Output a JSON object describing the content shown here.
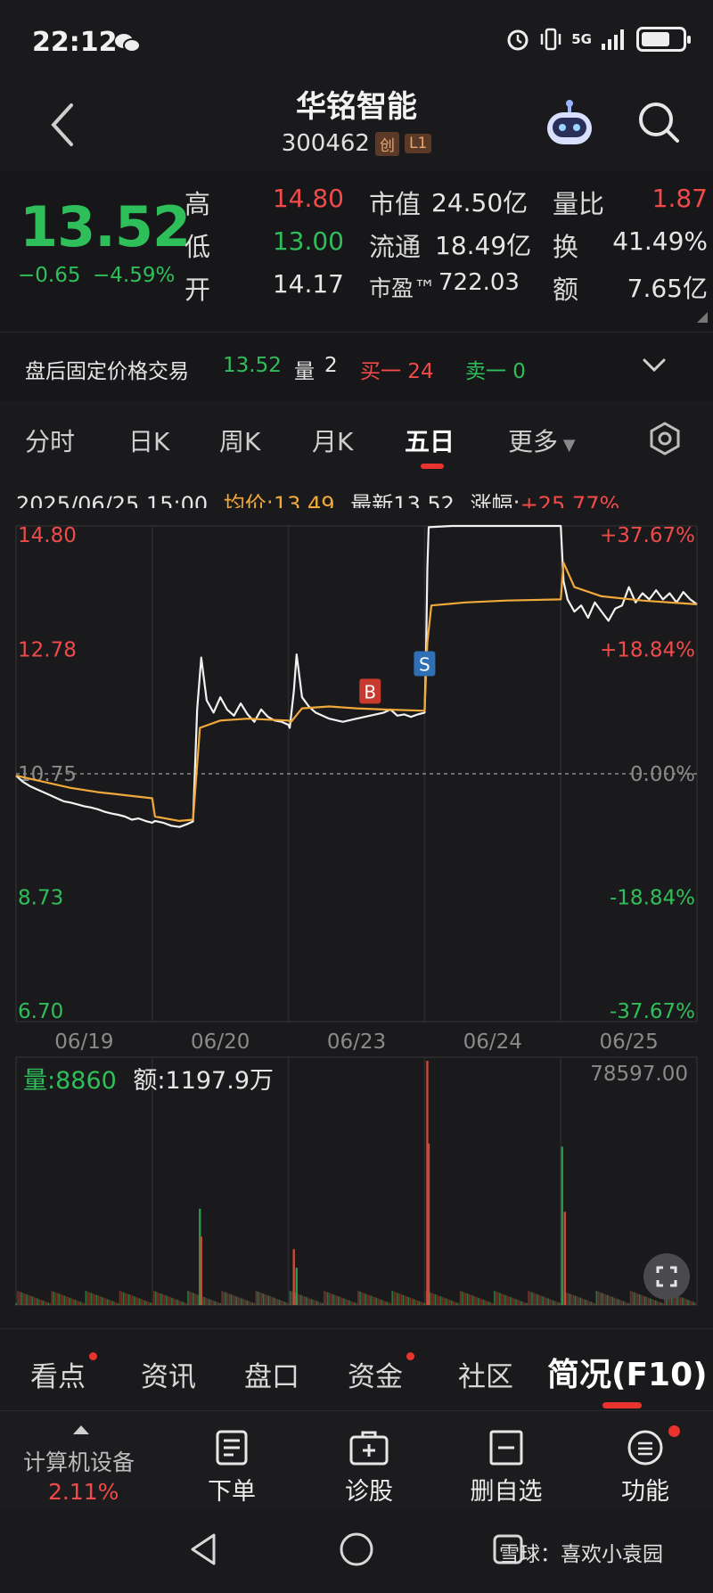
{
  "status": {
    "time": "22:12",
    "network": "5G",
    "battery_level": 0.7,
    "icons": [
      "wechat-icon",
      "alarm-icon",
      "vibrate-icon",
      "signal-icon",
      "battery-icon"
    ]
  },
  "header": {
    "name": "华铭智能",
    "code": "300462",
    "tags": [
      "创",
      "L1"
    ]
  },
  "quote": {
    "price": "13.52",
    "change": "−0.65",
    "change_pct": "−4.59%",
    "rows": [
      {
        "l1": "高",
        "v1": "14.80",
        "l2": "市值",
        "v2": "24.50亿",
        "l3": "量比",
        "v3": "1.87"
      },
      {
        "l1": "低",
        "v1": "13.00",
        "l2": "流通",
        "v2": "18.49亿",
        "l3": "换",
        "v3": "41.49%"
      },
      {
        "l1": "开",
        "v1": "14.17",
        "l2": "市盈™",
        "v2": "722.03",
        "l3": "额",
        "v3": "7.65亿"
      }
    ]
  },
  "after_hours": {
    "label": "盘后固定价格交易",
    "price": "13.52",
    "vol_label": "量",
    "vol": "2",
    "buy": "买一 24",
    "sell": "卖一 0"
  },
  "tabs": [
    "分时",
    "日K",
    "周K",
    "月K",
    "五日",
    "更多"
  ],
  "active_tab": "五日",
  "info_line": {
    "datetime": "2025/06/25 15:00",
    "avg": "均价:13.49",
    "latest": "最新13.52",
    "change_label": "涨幅:",
    "change": "+25.77%"
  },
  "chart_data": {
    "type": "line",
    "title": "",
    "dates": [
      "06/19",
      "06/20",
      "06/23",
      "06/24",
      "06/25"
    ],
    "y_ticks_left": [
      "14.80",
      "12.78",
      "10.75",
      "8.73",
      "6.70"
    ],
    "y_ticks_right": [
      "+37.67%",
      "+18.84%",
      "0.00%",
      "-18.84%",
      "-37.67%"
    ],
    "ylim": [
      6.7,
      14.8
    ],
    "base_price": 10.75,
    "series": [
      {
        "values": [
          [
            0.0,
            10.72
          ],
          [
            0.05,
            10.62
          ],
          [
            0.1,
            10.55
          ],
          [
            0.15,
            10.5
          ],
          [
            0.2,
            10.45
          ],
          [
            0.25,
            10.4
          ],
          [
            0.3,
            10.35
          ],
          [
            0.35,
            10.3
          ],
          [
            0.4,
            10.28
          ],
          [
            0.45,
            10.25
          ],
          [
            0.5,
            10.22
          ],
          [
            0.55,
            10.2
          ],
          [
            0.6,
            10.17
          ],
          [
            0.65,
            10.13
          ],
          [
            0.7,
            10.1
          ],
          [
            0.75,
            10.08
          ],
          [
            0.8,
            10.05
          ],
          [
            0.85,
            10.0
          ],
          [
            0.9,
            10.02
          ],
          [
            0.95,
            9.98
          ],
          [
            1.0,
            9.95
          ],
          [
            1.02,
            9.98
          ],
          [
            1.08,
            9.95
          ],
          [
            1.14,
            9.9
          ],
          [
            1.2,
            9.88
          ],
          [
            1.26,
            9.93
          ],
          [
            1.3,
            9.97
          ],
          [
            1.33,
            11.8
          ],
          [
            1.36,
            12.65
          ],
          [
            1.4,
            11.95
          ],
          [
            1.45,
            11.75
          ],
          [
            1.5,
            12.0
          ],
          [
            1.55,
            11.8
          ],
          [
            1.6,
            11.7
          ],
          [
            1.65,
            11.9
          ],
          [
            1.7,
            11.72
          ],
          [
            1.75,
            11.6
          ],
          [
            1.8,
            11.8
          ],
          [
            1.85,
            11.68
          ],
          [
            1.9,
            11.62
          ],
          [
            1.95,
            11.6
          ],
          [
            2.0,
            11.55
          ],
          [
            2.01,
            11.5
          ],
          [
            2.04,
            12.1
          ],
          [
            2.06,
            12.7
          ],
          [
            2.1,
            12.0
          ],
          [
            2.15,
            11.85
          ],
          [
            2.2,
            11.75
          ],
          [
            2.3,
            11.65
          ],
          [
            2.4,
            11.6
          ],
          [
            2.5,
            11.65
          ],
          [
            2.6,
            11.7
          ],
          [
            2.7,
            11.75
          ],
          [
            2.75,
            11.8
          ],
          [
            2.8,
            11.7
          ],
          [
            2.85,
            11.72
          ],
          [
            2.9,
            11.68
          ],
          [
            2.95,
            11.72
          ],
          [
            3.0,
            11.75
          ],
          [
            3.01,
            12.6
          ],
          [
            3.02,
            14.1
          ],
          [
            3.03,
            14.78
          ],
          [
            3.2,
            14.8
          ],
          [
            3.5,
            14.8
          ],
          [
            3.8,
            14.8
          ],
          [
            4.0,
            14.8
          ],
          [
            4.02,
            13.9
          ],
          [
            4.05,
            13.6
          ],
          [
            4.1,
            13.4
          ],
          [
            4.15,
            13.5
          ],
          [
            4.2,
            13.3
          ],
          [
            4.25,
            13.55
          ],
          [
            4.3,
            13.4
          ],
          [
            4.35,
            13.25
          ],
          [
            4.4,
            13.45
          ],
          [
            4.45,
            13.5
          ],
          [
            4.5,
            13.8
          ],
          [
            4.55,
            13.55
          ],
          [
            4.6,
            13.7
          ],
          [
            4.65,
            13.6
          ],
          [
            4.7,
            13.75
          ],
          [
            4.75,
            13.6
          ],
          [
            4.8,
            13.7
          ],
          [
            4.85,
            13.55
          ],
          [
            4.9,
            13.72
          ],
          [
            4.95,
            13.6
          ],
          [
            5.0,
            13.52
          ]
        ]
      },
      {
        "values": [
          [
            0.0,
            10.72
          ],
          [
            0.2,
            10.62
          ],
          [
            0.4,
            10.52
          ],
          [
            0.6,
            10.45
          ],
          [
            0.8,
            10.4
          ],
          [
            1.0,
            10.35
          ],
          [
            1.02,
            10.05
          ],
          [
            1.2,
            9.98
          ],
          [
            1.3,
            10.0
          ],
          [
            1.35,
            11.5
          ],
          [
            1.5,
            11.62
          ],
          [
            1.7,
            11.65
          ],
          [
            2.0,
            11.62
          ],
          [
            2.02,
            11.6
          ],
          [
            2.1,
            11.82
          ],
          [
            2.3,
            11.85
          ],
          [
            2.5,
            11.82
          ],
          [
            2.7,
            11.8
          ],
          [
            3.0,
            11.78
          ],
          [
            3.02,
            12.9
          ],
          [
            3.05,
            13.5
          ],
          [
            3.3,
            13.55
          ],
          [
            3.6,
            13.58
          ],
          [
            4.0,
            13.6
          ],
          [
            4.02,
            14.2
          ],
          [
            4.1,
            13.8
          ],
          [
            4.3,
            13.65
          ],
          [
            4.6,
            13.58
          ],
          [
            5.0,
            13.52
          ]
        ]
      }
    ],
    "markers": [
      {
        "label": "B",
        "x": 2.6,
        "y": 12.1,
        "color": "#c93a2e"
      },
      {
        "label": "S",
        "x": 3.0,
        "y": 12.55,
        "color": "#2f6fb5"
      }
    ],
    "volume": {
      "label": "量:",
      "value": "8860",
      "amount": "额:1197.9万",
      "max_label": "78597.00",
      "ylim": [
        0,
        78597
      ],
      "spikes": [
        {
          "x": 1.35,
          "v": 31000,
          "color": "#2a9a4a"
        },
        {
          "x": 1.36,
          "v": 22000,
          "color": "#c94a3a"
        },
        {
          "x": 2.04,
          "v": 18000,
          "color": "#c94a3a"
        },
        {
          "x": 2.06,
          "v": 12000,
          "color": "#2a9a4a"
        },
        {
          "x": 3.02,
          "v": 78597,
          "color": "#c94a3a"
        },
        {
          "x": 3.03,
          "v": 52000,
          "color": "#c94a3a"
        },
        {
          "x": 4.01,
          "v": 51000,
          "color": "#2a9a4a"
        },
        {
          "x": 4.03,
          "v": 30000,
          "color": "#c94a3a"
        }
      ]
    }
  },
  "bottom_tabs": [
    "看点",
    "资讯",
    "盘口",
    "资金",
    "社区",
    "简况(F10)"
  ],
  "bottom_active": "简况(F10)",
  "action_bar": {
    "sector": "计算机设备",
    "sector_pct": "2.11%",
    "actions": [
      "下单",
      "诊股",
      "删自选",
      "功能"
    ]
  },
  "watermark": "雪球：喜欢小袁园",
  "colors": {
    "up": "#f04a4a",
    "down": "#2fbf5a",
    "avg": "#f0a93a",
    "bg": "#1a1a1c"
  }
}
